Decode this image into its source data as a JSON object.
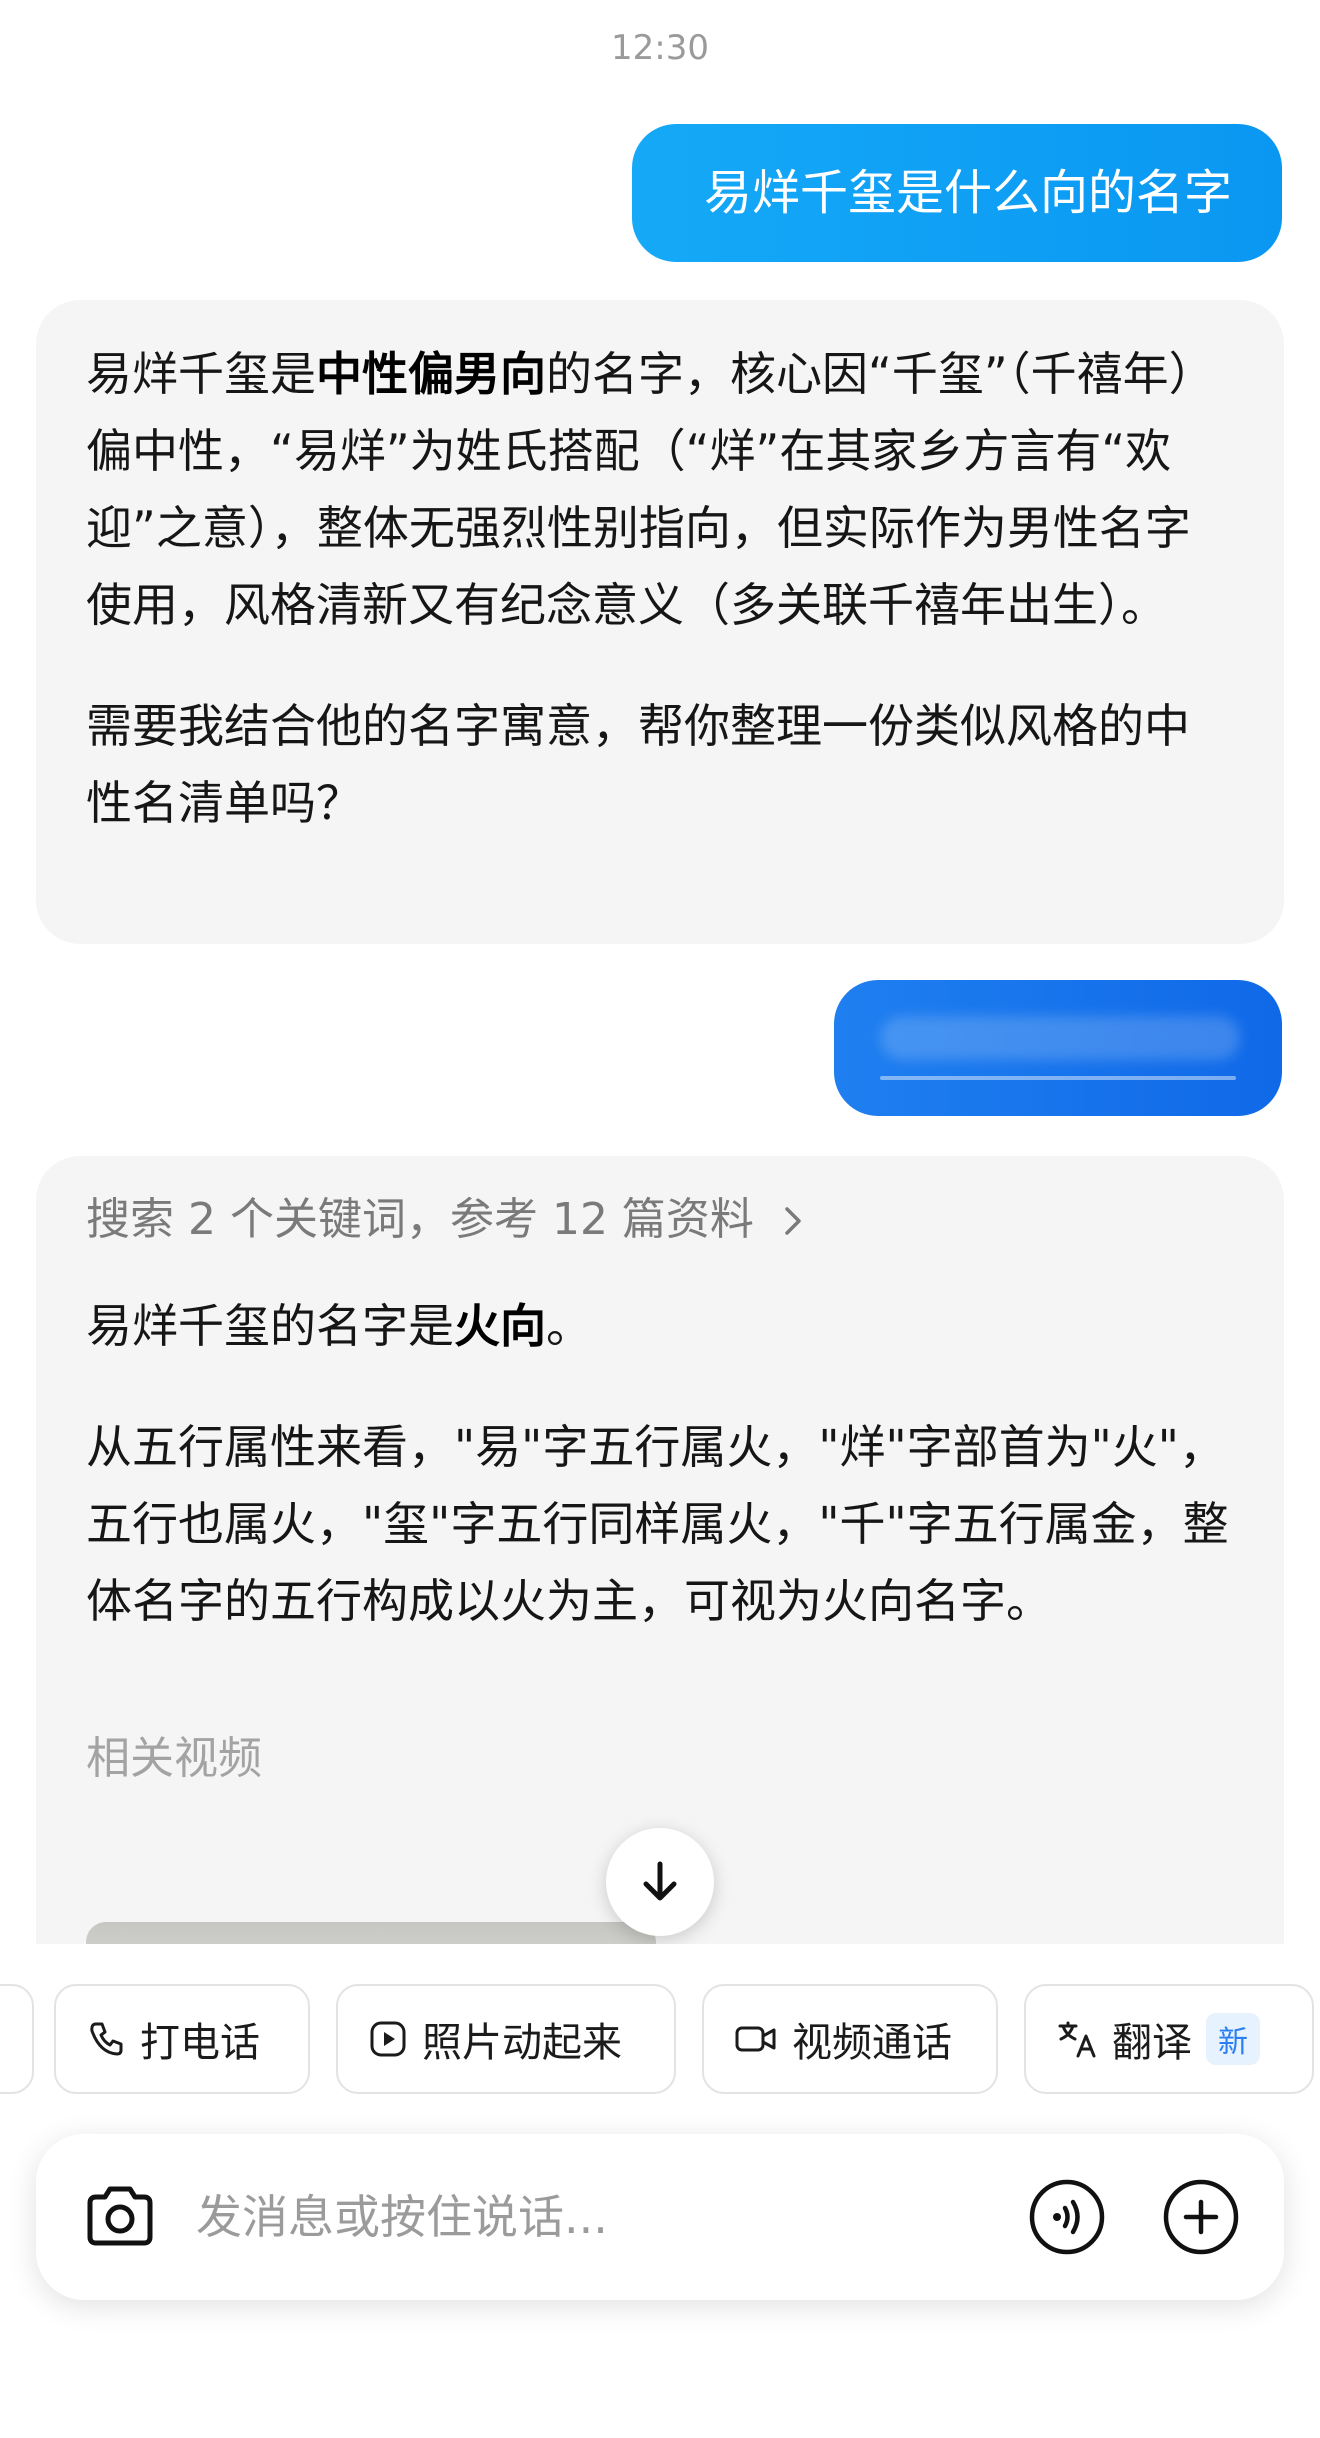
{
  "status": {
    "time": "12:30"
  },
  "messages": {
    "user_1": "易烊千玺是什么向的名字",
    "ai_1": {
      "p1_before": "易烊千玺是",
      "p1_bold": "中性偏男向",
      "p1_after": "的名字，核心因“千玺”（千禧年）偏中性，“易烊”为姓氏搭配（“烊”在其家乡方言有“欢迎”之意），整体无强烈性别指向，但实际作为男性名字使用，风格清新又有纪念意义（多关联千禧年出生）。",
      "p2": "需要我结合他的名字寓意，帮你整理一份类似风格的中性名清单吗？"
    },
    "user_2": "",
    "ai_2": {
      "search_summary": "搜索 2 个关键词，参考 12 篇资料",
      "p1_before": "易烊千玺的名字是",
      "p1_bold": "火向",
      "p1_after": "。",
      "p2": "从五行属性来看，\"易\"字五行属火，\"烊\"字部首为\"火\"，五行也属火，\"玺\"字五行同样属火，\"千\"字五行属金，整体名字的五行构成以火为主，可视为火向名字。",
      "related_label": "相关视频"
    }
  },
  "quick_actions": {
    "call": "打电话",
    "photo_animate": "照片动起来",
    "video_call": "视频通话",
    "translate": "翻译",
    "translate_badge": "新"
  },
  "input": {
    "placeholder": "发消息或按住说话..."
  },
  "icons": [
    "chevron-right-icon",
    "arrow-down-icon",
    "phone-icon",
    "play-square-icon",
    "video-camera-icon",
    "translate-icon",
    "camera-icon",
    "voice-wave-icon",
    "plus-circle-icon"
  ],
  "colors": {
    "user_bubble": "#0A97F2",
    "ai_bubble": "#F5F5F5",
    "badge_text": "#2B7EF2"
  }
}
